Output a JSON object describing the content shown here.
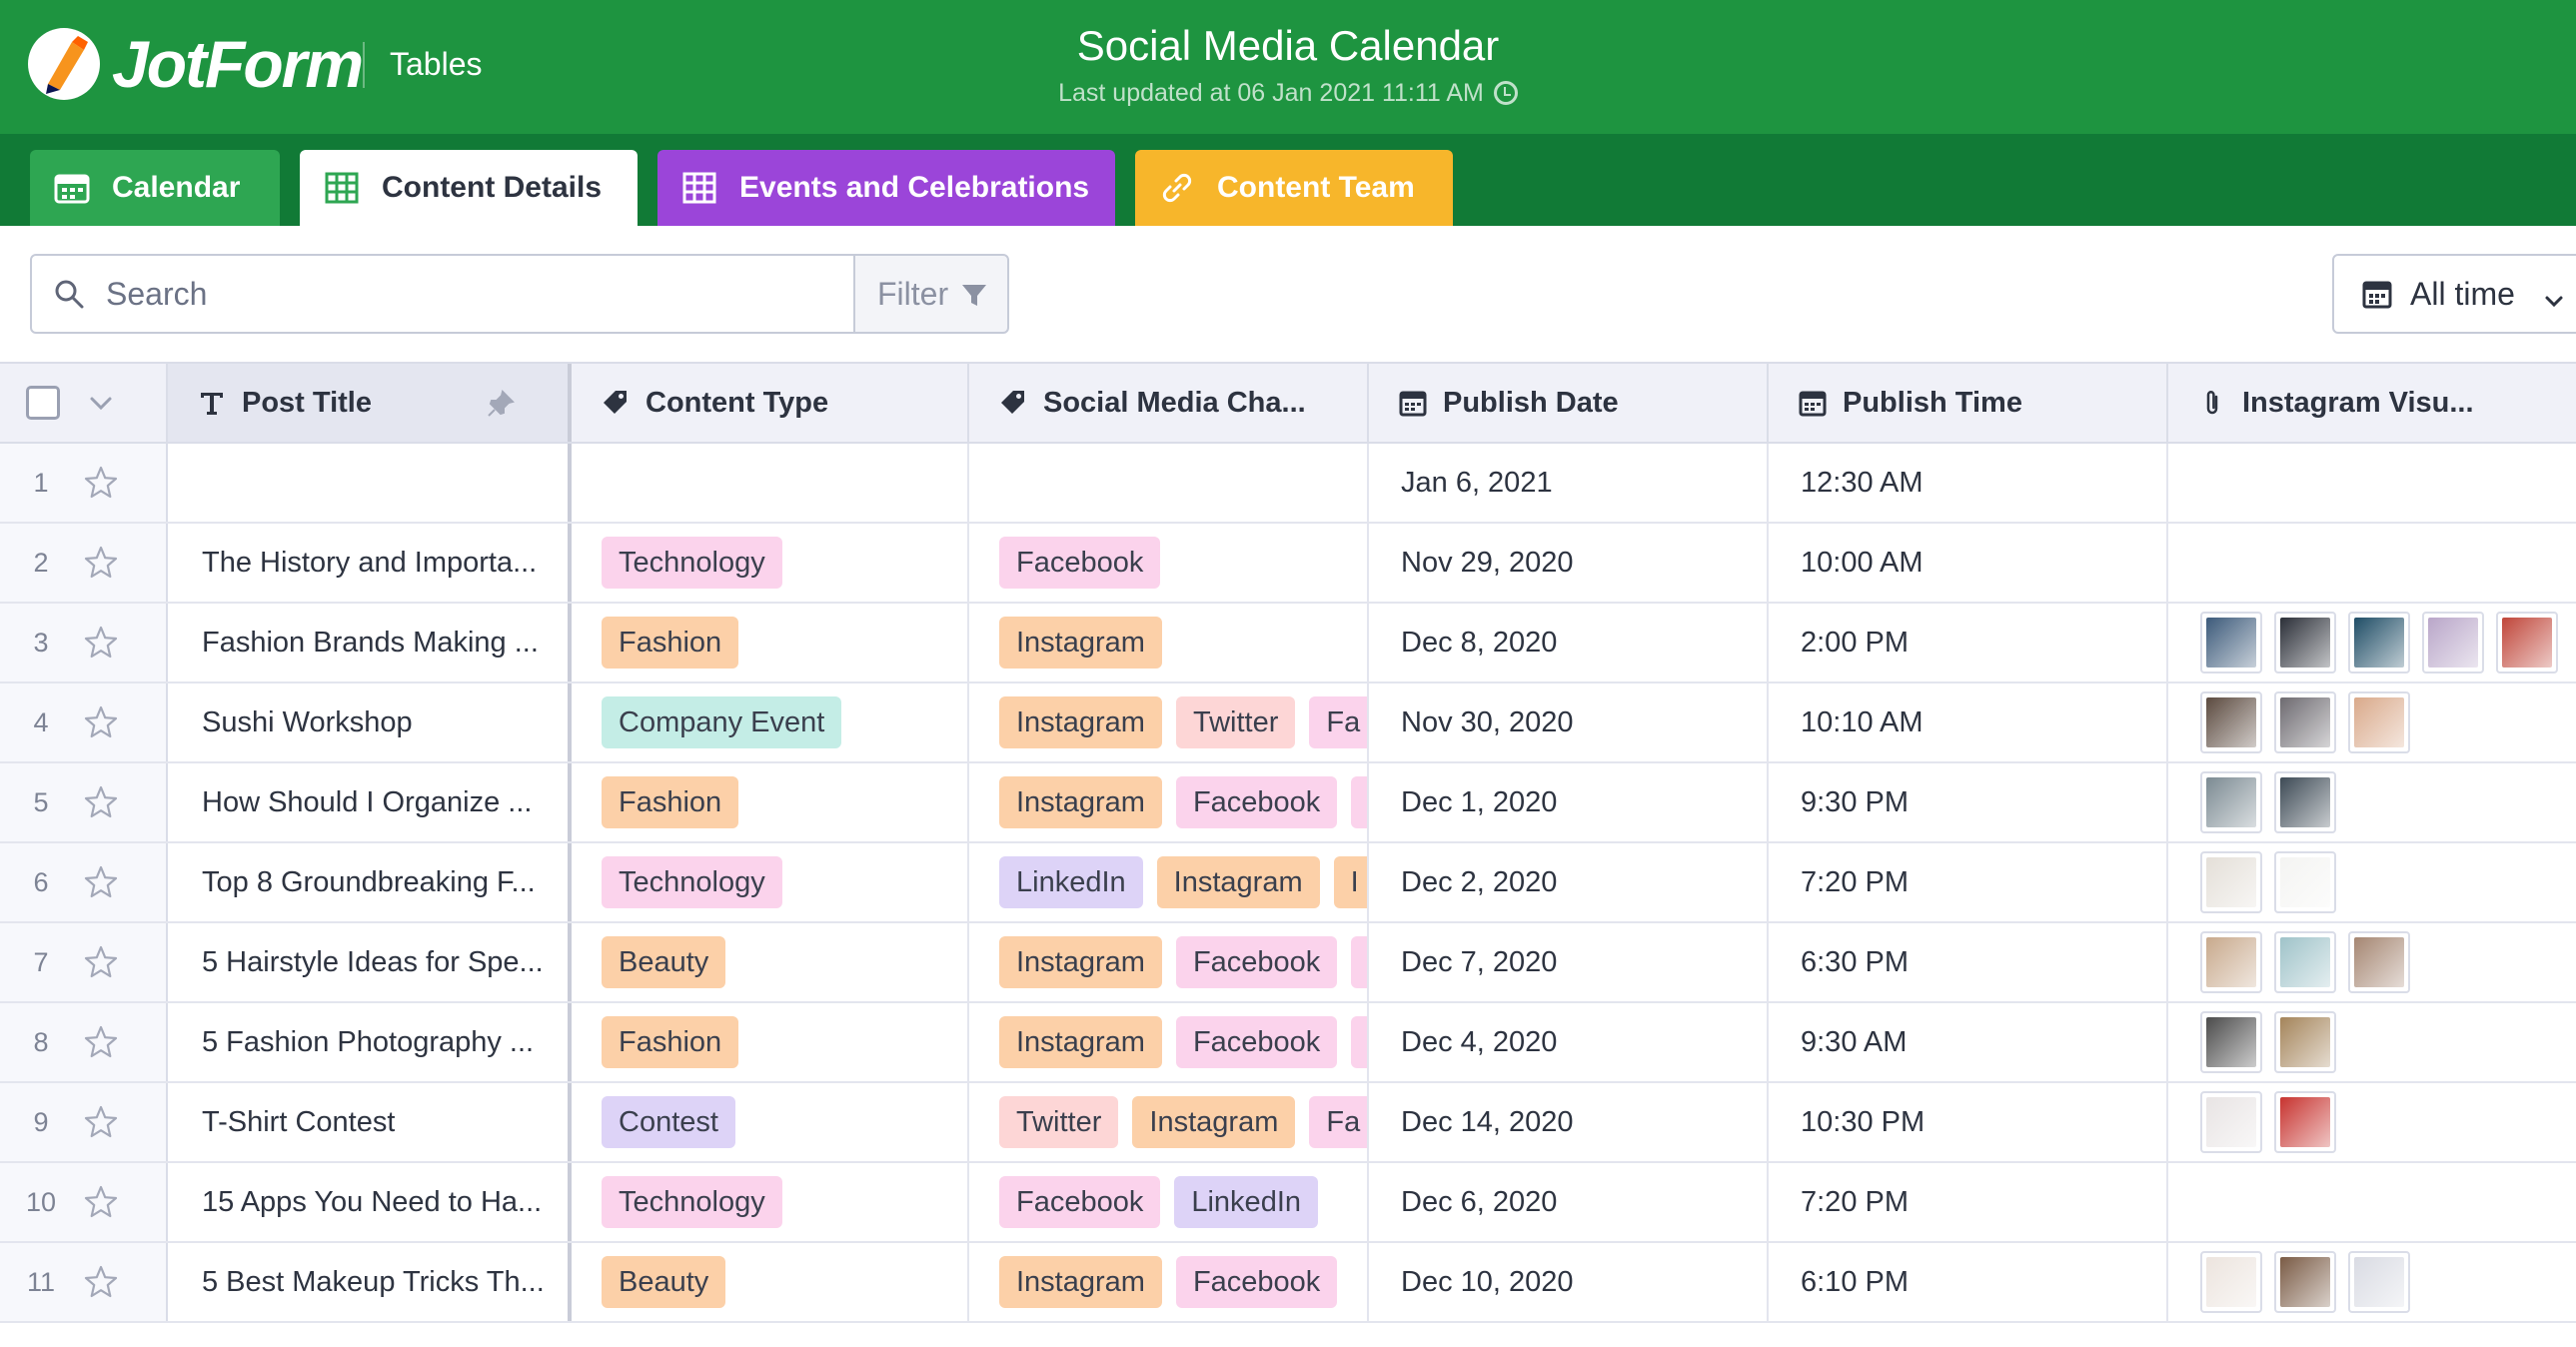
{
  "app": {
    "brand": "JotForm",
    "section": "Tables"
  },
  "document": {
    "title": "Social Media Calendar",
    "last_updated": "Last updated at 06 Jan 2021 11:11 AM"
  },
  "tabs": [
    {
      "label": "Calendar",
      "color": "#2ea652",
      "icon": "calendar-icon"
    },
    {
      "label": "Content Details",
      "color": "#ffffff",
      "icon": "grid-icon",
      "active": true
    },
    {
      "label": "Events and Celebrations",
      "color": "#9b45d9",
      "icon": "grid-icon"
    },
    {
      "label": "Content Team",
      "color": "#f7b62b",
      "icon": "link-icon"
    }
  ],
  "toolbar": {
    "search_placeholder": "Search",
    "filter_label": "Filter",
    "date_range_label": "All time"
  },
  "columns": [
    {
      "label": "Post Title",
      "icon": "text-type-icon"
    },
    {
      "label": "Content Type",
      "icon": "tag-icon"
    },
    {
      "label": "Social Media Cha...",
      "icon": "tag-icon"
    },
    {
      "label": "Publish Date",
      "icon": "calendar-icon"
    },
    {
      "label": "Publish Time",
      "icon": "calendar-icon"
    },
    {
      "label": "Instagram Visu...",
      "icon": "paperclip-icon"
    }
  ],
  "tag_colors": {
    "Technology": "#fbd3ec",
    "Fashion": "#fcd0a8",
    "Company Event": "#c4ede6",
    "Beauty": "#fcd0a8",
    "Contest": "#ddd3f7",
    "Facebook": "#fbd3ec",
    "Instagram": "#fcd0a8",
    "Twitter": "#fdd6d6",
    "LinkedIn": "#ddd3f7",
    "Fa": "#fbd3ec",
    "I": "#fcd0a8",
    "": "#fbd3ec"
  },
  "rows": [
    {
      "num": "1",
      "title": "",
      "type": [],
      "channels": [],
      "date": "Jan 6, 2021",
      "time": "12:30 AM",
      "visuals": []
    },
    {
      "num": "2",
      "title": "The History and Importa...",
      "type": [
        "Technology"
      ],
      "channels": [
        "Facebook"
      ],
      "date": "Nov 29, 2020",
      "time": "10:00 AM",
      "visuals": []
    },
    {
      "num": "3",
      "title": "Fashion Brands Making ...",
      "type": [
        "Fashion"
      ],
      "channels": [
        "Instagram"
      ],
      "date": "Dec 8, 2020",
      "time": "2:00 PM",
      "visuals": [
        "#3c5a7a",
        "#2b2f38",
        "#1f4d66",
        "#b9a6c9",
        "#c0463a"
      ]
    },
    {
      "num": "4",
      "title": "Sushi Workshop",
      "type": [
        "Company Event"
      ],
      "channels": [
        "Instagram",
        "Twitter",
        "Fa"
      ],
      "date": "Nov 30, 2020",
      "time": "10:10 AM",
      "visuals": [
        "#5b4a3f",
        "#6d6a70",
        "#d9a98a"
      ]
    },
    {
      "num": "5",
      "title": "How Should I Organize ...",
      "type": [
        "Fashion"
      ],
      "channels": [
        "Instagram",
        "Facebook",
        ""
      ],
      "date": "Dec 1, 2020",
      "time": "9:30 PM",
      "visuals": [
        "#7b8a92",
        "#3d4a55"
      ]
    },
    {
      "num": "6",
      "title": "Top 8 Groundbreaking F...",
      "type": [
        "Technology"
      ],
      "channels": [
        "LinkedIn",
        "Instagram",
        "I"
      ],
      "date": "Dec 2, 2020",
      "time": "7:20 PM",
      "visuals": [
        "#e4dfd8",
        "#f4f4f2"
      ]
    },
    {
      "num": "7",
      "title": "5 Hairstyle Ideas for Spe...",
      "type": [
        "Beauty"
      ],
      "channels": [
        "Instagram",
        "Facebook",
        ""
      ],
      "date": "Dec 7, 2020",
      "time": "6:30 PM",
      "visuals": [
        "#c8a98c",
        "#9fc3c9",
        "#a58672"
      ]
    },
    {
      "num": "8",
      "title": "5 Fashion Photography ...",
      "type": [
        "Fashion"
      ],
      "channels": [
        "Instagram",
        "Facebook",
        ""
      ],
      "date": "Dec 4, 2020",
      "time": "9:30 AM",
      "visuals": [
        "#4b4b4b",
        "#a4845a"
      ]
    },
    {
      "num": "9",
      "title": "T-Shirt Contest",
      "type": [
        "Contest"
      ],
      "channels": [
        "Twitter",
        "Instagram",
        "Fa"
      ],
      "date": "Dec 14, 2020",
      "time": "10:30 PM",
      "visuals": [
        "#e8e4e4",
        "#c7332f"
      ]
    },
    {
      "num": "10",
      "title": "15 Apps You Need to Ha...",
      "type": [
        "Technology"
      ],
      "channels": [
        "Facebook",
        "LinkedIn"
      ],
      "date": "Dec 6, 2020",
      "time": "7:20 PM",
      "visuals": []
    },
    {
      "num": "11",
      "title": "5 Best Makeup Tricks Th...",
      "type": [
        "Beauty"
      ],
      "channels": [
        "Instagram",
        "Facebook"
      ],
      "date": "Dec 10, 2020",
      "time": "6:10 PM",
      "visuals": [
        "#ece4de",
        "#7a5b45",
        "#d9dbe3"
      ]
    }
  ]
}
